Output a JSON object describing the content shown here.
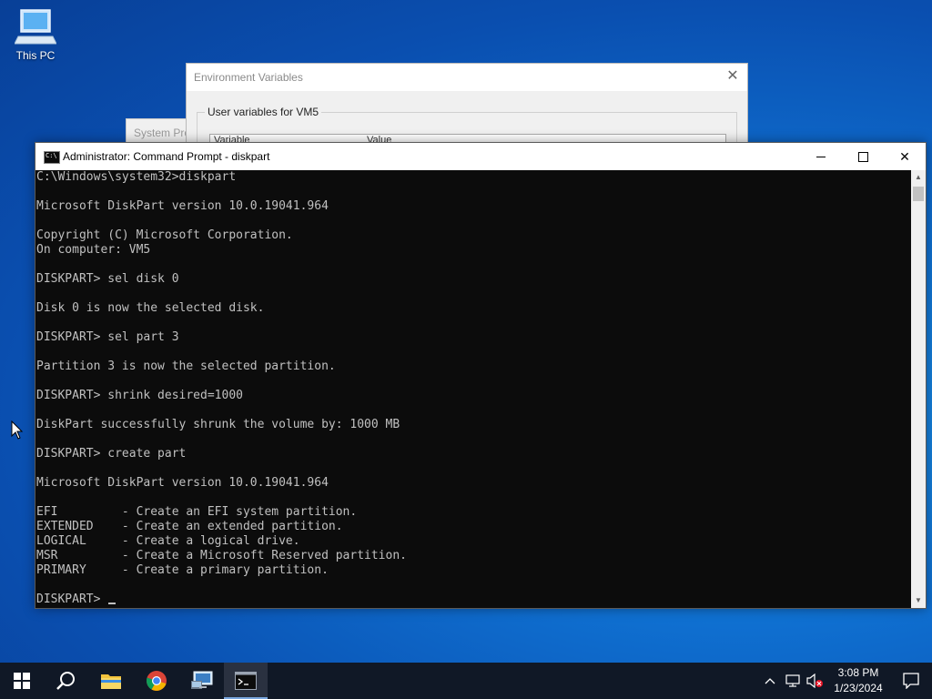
{
  "desktop": {
    "icons": [
      {
        "label": "This PC",
        "icon": "computer-icon"
      }
    ]
  },
  "system_properties_window": {
    "title": "System Pro"
  },
  "env_vars_window": {
    "title": "Environment Variables",
    "group_label": "User variables for VM5",
    "columns": [
      "Variable",
      "Value"
    ]
  },
  "cmd_window": {
    "title": "Administrator: Command Prompt - diskpart",
    "lines": [
      "C:\\Windows\\system32>diskpart",
      "",
      "Microsoft DiskPart version 10.0.19041.964",
      "",
      "Copyright (C) Microsoft Corporation.",
      "On computer: VM5",
      "",
      "DISKPART> sel disk 0",
      "",
      "Disk 0 is now the selected disk.",
      "",
      "DISKPART> sel part 3",
      "",
      "Partition 3 is now the selected partition.",
      "",
      "DISKPART> shrink desired=1000",
      "",
      "DiskPart successfully shrunk the volume by: 1000 MB",
      "",
      "DISKPART> create part",
      "",
      "Microsoft DiskPart version 10.0.19041.964",
      "",
      "EFI         - Create an EFI system partition.",
      "EXTENDED    - Create an extended partition.",
      "LOGICAL     - Create a logical drive.",
      "MSR         - Create a Microsoft Reserved partition.",
      "PRIMARY     - Create a primary partition.",
      ""
    ],
    "prompt": "DISKPART> "
  },
  "taskbar": {
    "apps": [
      "start-icon",
      "search-icon",
      "file-explorer-icon",
      "chrome-icon",
      "remote-desktop-icon",
      "command-prompt-icon"
    ],
    "active_app": "command-prompt-icon",
    "clock_time": "3:08 PM",
    "clock_date": "1/23/2024"
  },
  "colors": {
    "console_bg": "#0c0c0c",
    "console_text": "#c0c0c0",
    "taskbar_bg": "#101826",
    "desktop_bg": "#0f6fd0"
  }
}
